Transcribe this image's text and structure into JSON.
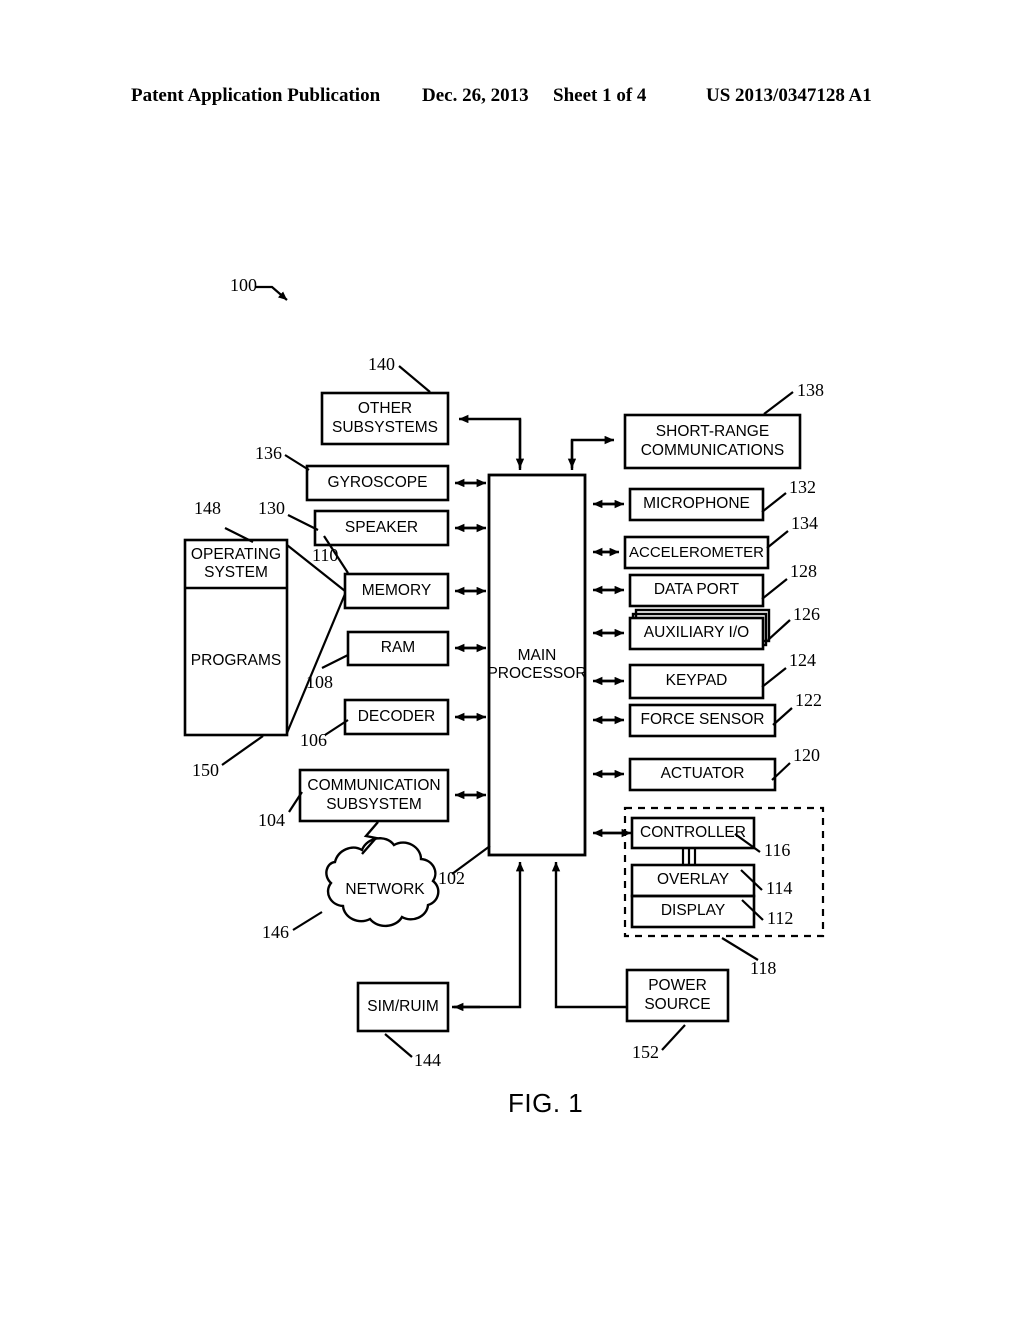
{
  "header": {
    "publication": "Patent Application Publication",
    "date": "Dec. 26, 2013",
    "sheet": "Sheet 1 of 4",
    "document_number": "US 2013/0347128 A1"
  },
  "figure": {
    "caption": "FIG. 1",
    "system_ref": "100",
    "blocks": {
      "other_subsystems": "OTHER\nSUBSYSTEMS",
      "gyroscope": "GYROSCOPE",
      "speaker": "SPEAKER",
      "memory": "MEMORY",
      "ram": "RAM",
      "decoder": "DECODER",
      "communication_subsystem": "COMMUNICATION\nSUBSYSTEM",
      "operating_system": "OPERATING\nSYSTEM",
      "programs": "PROGRAMS",
      "network": "NETWORK",
      "sim_ruim": "SIM/RUIM",
      "main_processor": "MAIN\nPROCESSOR",
      "short_range_communications": "SHORT-RANGE\nCOMMUNICATIONS",
      "microphone": "MICROPHONE",
      "accelerometer": "ACCELEROMETER",
      "data_port": "DATA PORT",
      "auxiliary_io": "AUXILIARY I/O",
      "keypad": "KEYPAD",
      "force_sensor": "FORCE SENSOR",
      "actuator": "ACTUATOR",
      "controller": "CONTROLLER",
      "overlay": "OVERLAY",
      "display": "DISPLAY",
      "power_source": "POWER\nSOURCE"
    },
    "reference_numerals": {
      "system": "100",
      "main_processor": "102",
      "communication_subsystem": "104",
      "decoder": "106",
      "ram": "108",
      "memory": "110",
      "display": "112",
      "overlay": "114",
      "controller": "116",
      "touch_sensitive_display": "118",
      "actuator": "120",
      "force_sensor": "122",
      "keypad": "124",
      "auxiliary_io": "126",
      "data_port": "128",
      "speaker": "130",
      "microphone": "132",
      "accelerometer": "134",
      "gyroscope": "136",
      "short_range_communications": "138",
      "other_subsystems": "140",
      "sim_ruim": "144",
      "network": "146",
      "operating_system": "148",
      "programs": "150",
      "power_source": "152"
    }
  }
}
